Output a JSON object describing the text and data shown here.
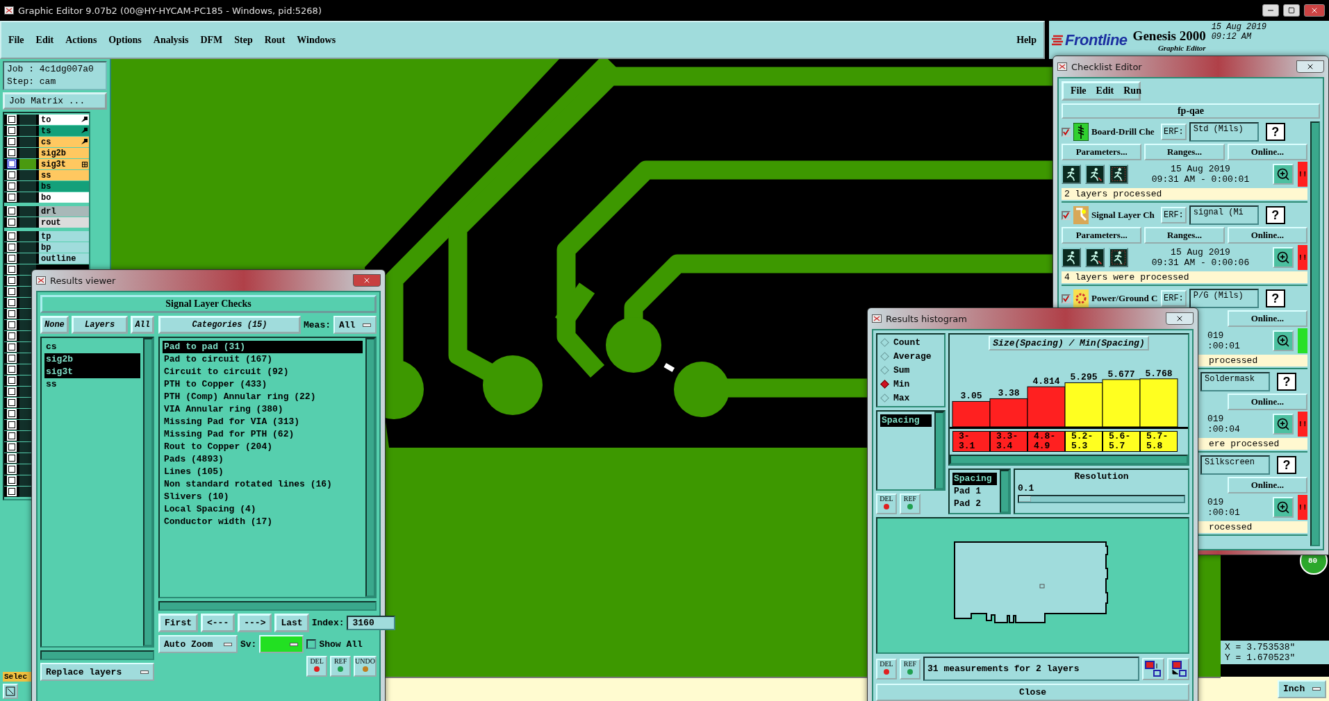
{
  "window": {
    "title": "Graphic Editor 9.07b2 (00@HY-HYCAM-PC185 - Windows, pid:5268)"
  },
  "menu": [
    "File",
    "Edit",
    "Actions",
    "Options",
    "Analysis",
    "DFM",
    "Step",
    "Rout",
    "Windows"
  ],
  "help": "Help",
  "brand": {
    "logo": "Frontline",
    "product": "Genesis 2000",
    "subtitle": "Graphic Editor",
    "date": "15 Aug 2019",
    "time": "09:12 AM"
  },
  "job": {
    "job": "Job : 4c1dg007a0",
    "step": "Step: cam",
    "matrix_button": "Job Matrix ..."
  },
  "layers": [
    {
      "name": "to",
      "color": "#ffffff",
      "checked": false,
      "active": false
    },
    {
      "name": "ts",
      "color": "#14a07a",
      "checked": false,
      "active": false
    },
    {
      "name": "cs",
      "color": "#ffc860",
      "checked": false,
      "active": false
    },
    {
      "name": "sig2b",
      "color": "#ffc860",
      "checked": false,
      "active": false
    },
    {
      "name": "sig3t",
      "color": "#ffc860",
      "checked": false,
      "active": true
    },
    {
      "name": "ss",
      "color": "#ffc860",
      "checked": false,
      "active": false
    },
    {
      "name": "bs",
      "color": "#14a07a",
      "checked": false,
      "active": false
    },
    {
      "name": "bo",
      "color": "#ffffff",
      "checked": false,
      "active": false
    },
    {
      "name": "drl",
      "color": "#a8b8b8",
      "checked": false,
      "active": false
    },
    {
      "name": "rout",
      "color": "#dcdcdc",
      "checked": false,
      "active": false
    },
    {
      "name": "tp",
      "color": "#a0dcdc",
      "checked": false,
      "active": false
    },
    {
      "name": "bp",
      "color": "#a0dcdc",
      "checked": false,
      "active": false
    },
    {
      "name": "outline",
      "color": "#a0dcdc",
      "checked": false,
      "active": false
    },
    {
      "checked": false,
      "active": false
    },
    {
      "checked": false,
      "active": false
    },
    {
      "checked": false,
      "active": false
    },
    {
      "checked": false,
      "active": false
    },
    {
      "checked": false,
      "active": false
    },
    {
      "checked": false,
      "active": false
    },
    {
      "checked": false,
      "active": false
    },
    {
      "checked": false,
      "active": false
    },
    {
      "checked": false,
      "active": false
    },
    {
      "checked": false,
      "active": false
    },
    {
      "checked": false,
      "active": false
    },
    {
      "checked": false,
      "active": false
    },
    {
      "checked": false,
      "active": false
    },
    {
      "checked": false,
      "active": false
    },
    {
      "checked": false,
      "active": false
    },
    {
      "checked": false,
      "active": false
    },
    {
      "checked": false,
      "active": false
    },
    {
      "checked": false,
      "active": false
    },
    {
      "checked": false,
      "active": false
    },
    {
      "checked": false,
      "active": false
    },
    {
      "checked": false,
      "active": false
    }
  ],
  "tool_label": "Selec",
  "coords": {
    "x": "X = 3.753538\"",
    "y": "Y = 1.670523\""
  },
  "units": "Inch",
  "zoom_badge": "80",
  "results_viewer": {
    "title": "Results viewer",
    "header": "Signal Layer Checks",
    "layer_buttons": [
      "None",
      "Layers",
      "All"
    ],
    "layers": [
      {
        "name": "cs",
        "selected": false
      },
      {
        "name": "sig2b",
        "selected": true
      },
      {
        "name": "sig3t",
        "selected": true
      },
      {
        "name": "ss",
        "selected": false
      }
    ],
    "categories_button": "Categories (15)",
    "meas_label": "Meas:",
    "meas_value": "All",
    "categories": [
      {
        "name": "Pad to pad (31)",
        "selected": true
      },
      {
        "name": "Pad to circuit (167)",
        "selected": false
      },
      {
        "name": "Circuit to circuit (92)",
        "selected": false
      },
      {
        "name": "PTH to Copper (433)",
        "selected": false
      },
      {
        "name": "PTH (Comp) Annular ring (22)",
        "selected": false
      },
      {
        "name": "VIA Annular ring (380)",
        "selected": false
      },
      {
        "name": "Missing Pad for VIA (313)",
        "selected": false
      },
      {
        "name": "Missing Pad for PTH (62)",
        "selected": false
      },
      {
        "name": "Rout to Copper (204)",
        "selected": false
      },
      {
        "name": "Pads (4893)",
        "selected": false
      },
      {
        "name": "Lines (105)",
        "selected": false
      },
      {
        "name": "Non standard rotated lines (16)",
        "selected": false
      },
      {
        "name": "Slivers (10)",
        "selected": false
      },
      {
        "name": "Local Spacing (4)",
        "selected": false
      },
      {
        "name": "Conductor width (17)",
        "selected": false
      }
    ],
    "nav_buttons": [
      "First",
      "<---",
      "--->",
      "Last"
    ],
    "index_label": "Index:",
    "index_value": "3160",
    "zoom_mode": "Auto Zoom",
    "sv_label": "Sv:",
    "severity": {
      "color": "#22e022"
    },
    "show_all": {
      "label": "Show All",
      "checked": false
    },
    "replace": "Replace layers",
    "action_buttons": [
      "DEL",
      "REF",
      "UNDO"
    ]
  },
  "histogram": {
    "title": "Results histogram",
    "modes": [
      {
        "label": "Count",
        "selected": false
      },
      {
        "label": "Average",
        "selected": false
      },
      {
        "label": "Sum",
        "selected": false
      },
      {
        "label": "Min",
        "selected": true
      },
      {
        "label": "Max",
        "selected": false
      }
    ],
    "measures": [
      {
        "name": "Spacing",
        "selected": true
      }
    ],
    "side_buttons": [
      "DEL",
      "REF"
    ],
    "chart_title": "Size(Spacing) / Min(Spacing)",
    "chart_data": {
      "type": "bar",
      "categories": [
        "3-3.1",
        "3.3-3.4",
        "4.8-4.9",
        "5.2-5.3",
        "5.6-5.7",
        "5.7-5.8"
      ],
      "series": [
        {
          "color": "#ff2020",
          "values": [
            3.05,
            3.38,
            4.814,
            null,
            null,
            null
          ]
        },
        {
          "color": "#ffff20",
          "values": [
            null,
            null,
            null,
            5.295,
            5.677,
            5.768
          ]
        }
      ],
      "data_labels": true
    },
    "value_labels": [
      "3.05",
      "3.38",
      "4.814",
      "5.295",
      "5.677",
      "5.768"
    ],
    "fields": [
      {
        "name": "Spacing",
        "selected": true
      },
      {
        "name": "Pad 1",
        "selected": false
      },
      {
        "name": "Pad 2",
        "selected": false
      }
    ],
    "resolution": {
      "label": "Resolution",
      "value": "0.1",
      "level": 0.07
    },
    "bottom_buttons": [
      "DEL",
      "REF"
    ],
    "message": "31 measurements for 2 layers",
    "close": "Close"
  },
  "checklist": {
    "title": "Checklist Editor",
    "menu": [
      "File",
      "Edit",
      "Run"
    ],
    "name": "fp-qae",
    "checks": [
      {
        "kind": "full",
        "checked": true,
        "name": "Board-Drill Che",
        "erf_label": "ERF:",
        "erf": "Std (Mils)",
        "help": "?",
        "buttons": [
          "Parameters...",
          "Ranges...",
          "Online..."
        ],
        "date": "15 Aug 2019",
        "time": "09:31 AM - 0:00:01",
        "color": "#ff2020",
        "flag": "!!",
        "message": "2 layers processed"
      },
      {
        "kind": "full",
        "checked": true,
        "name": "Signal Layer Ch",
        "erf_label": "ERF:",
        "erf": "signal (Mi",
        "help": "?",
        "buttons": [
          "Parameters...",
          "Ranges...",
          "Online..."
        ],
        "date": "15 Aug 2019",
        "time": "09:31 AM - 0:00:06",
        "color": "#ff2020",
        "flag": "!!",
        "message": "4 layers were processed"
      },
      {
        "kind": "body_covered",
        "checked": true,
        "name": "Power/Ground C",
        "erf_label": "ERF:",
        "erf": "P/G (Mils)",
        "help": "?",
        "buttons": [
          "Online..."
        ],
        "date": "019",
        "time": ":00:01",
        "color": "#28e028",
        "message": "processed"
      },
      {
        "kind": "all_covered",
        "erf": "Soldermask",
        "help": "?",
        "buttons": [
          "Online..."
        ],
        "date": "019",
        "time": ":00:04",
        "color": "#ff2020",
        "flag": "!!",
        "message": "ere processed"
      },
      {
        "kind": "all_covered",
        "erf": "Silkscreen",
        "help": "?",
        "buttons": [
          "Online..."
        ],
        "date": "019",
        "time": ":00:01",
        "color": "#ff2020",
        "flag": "!!",
        "message": "rocessed"
      }
    ]
  }
}
